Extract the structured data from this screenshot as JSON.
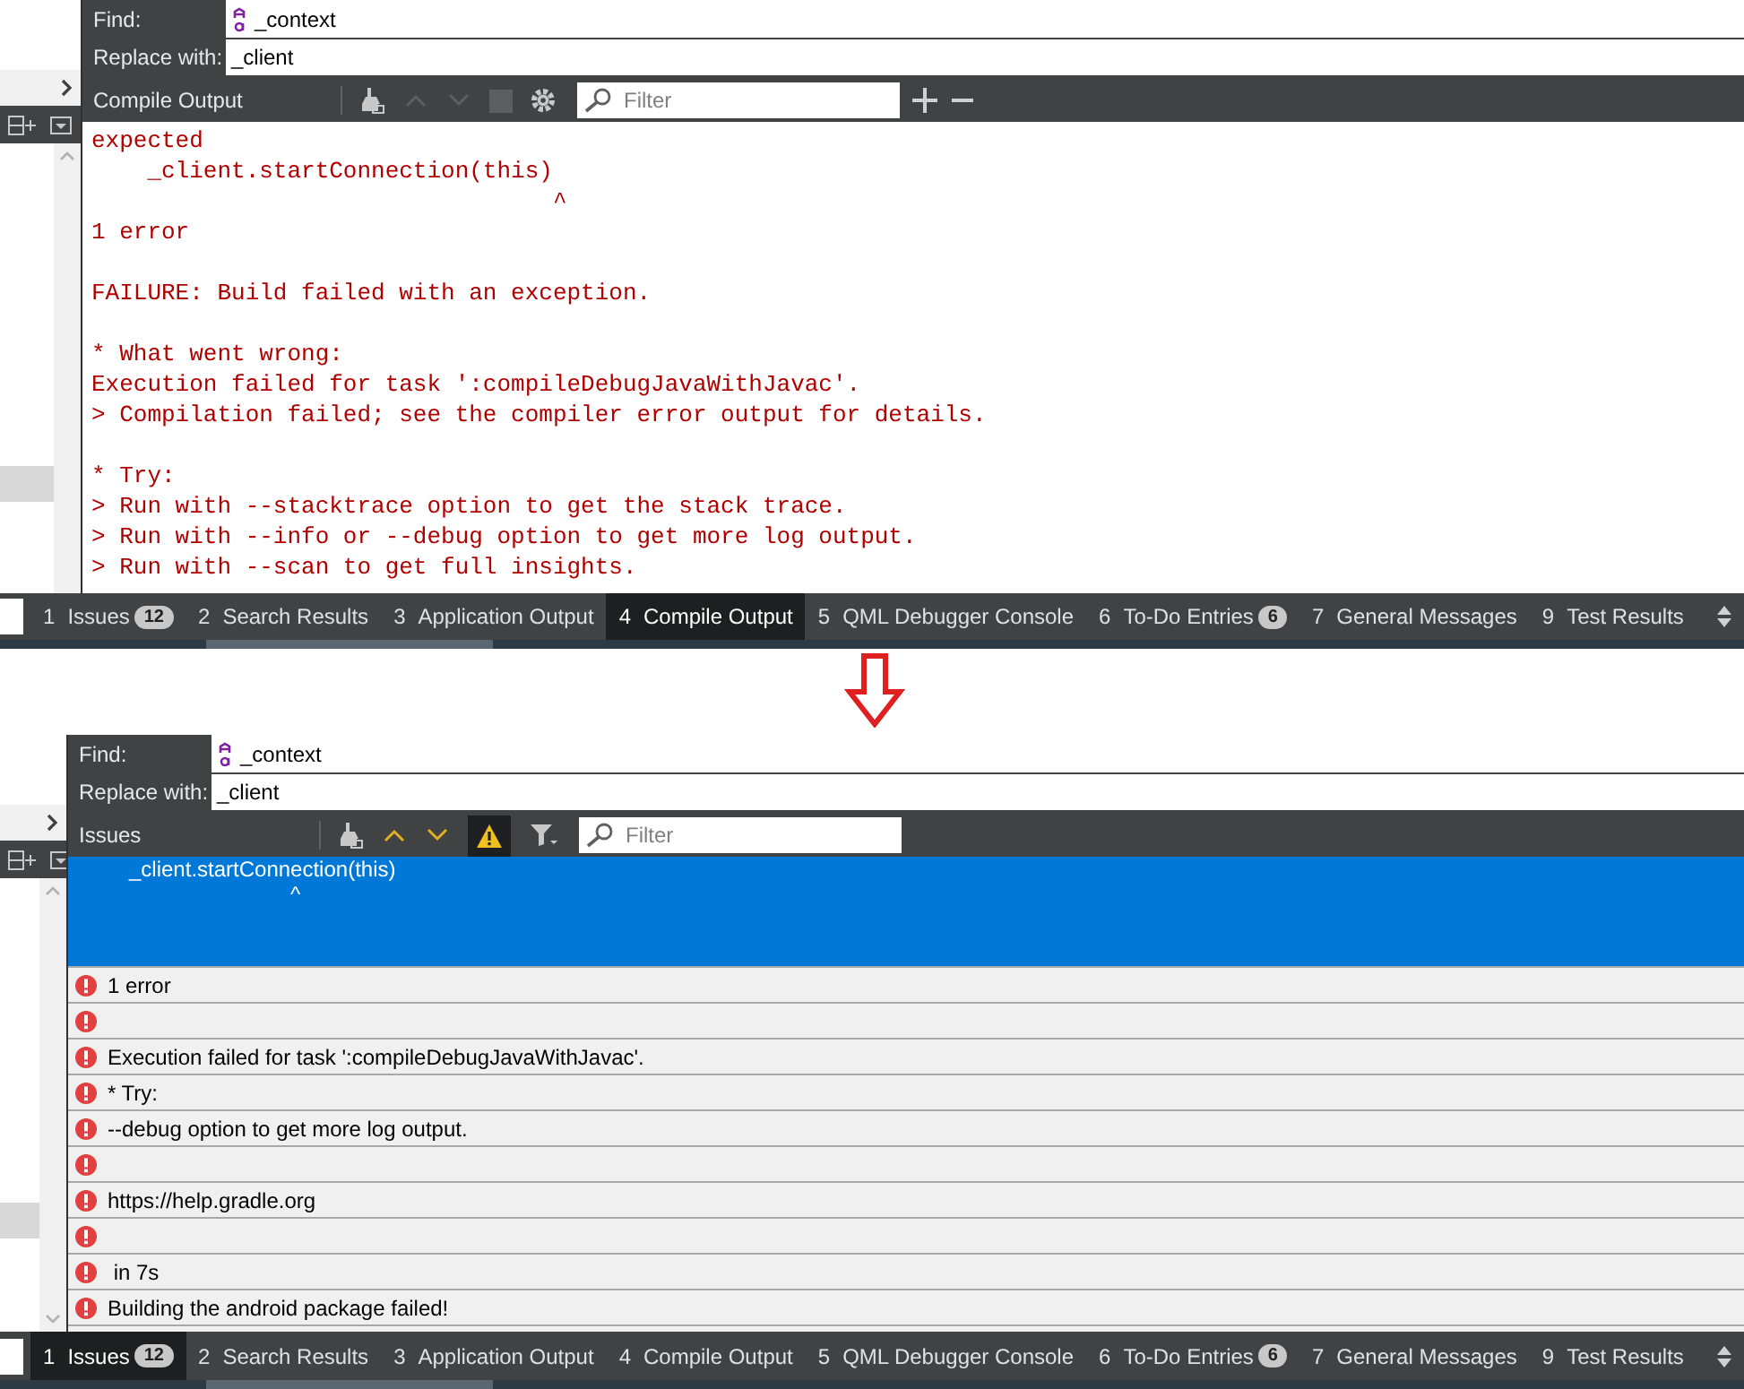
{
  "panels": [
    {
      "kind": "compile_output",
      "find": {
        "label": "Find:",
        "value": "_context"
      },
      "replace": {
        "label": "Replace with:",
        "value": "_client"
      },
      "pane_title": "Compile Output",
      "toolbar": [
        {
          "kind": "clean",
          "disabled": false
        },
        {
          "kind": "prev",
          "disabled": true
        },
        {
          "kind": "next",
          "disabled": true
        },
        {
          "kind": "stop",
          "disabled": true
        },
        {
          "kind": "settings",
          "disabled": false
        }
      ],
      "filter": {
        "placeholder": "Filter"
      },
      "zoom_buttons": true,
      "output_blocks": [
        [
          "expected",
          "    _client.startConnection(this)",
          "                                 ^",
          "1 error"
        ],
        [
          "FAILURE: Build failed with an exception."
        ],
        [
          "* What went wrong:",
          "Execution failed for task ':compileDebugJavaWithJavac'.",
          "> Compilation failed; see the compiler error output for details."
        ],
        [
          "* Try:",
          "> Run with --stacktrace option to get the stack trace.",
          "> Run with --info or --debug option to get more log output.",
          "> Run with --scan to get full insights."
        ]
      ],
      "tabs": [
        {
          "number": "1",
          "label": "Issues",
          "badge": "12",
          "selected": false
        },
        {
          "number": "2",
          "label": "Search Results",
          "selected": false
        },
        {
          "number": "3",
          "label": "Application Output",
          "selected": false
        },
        {
          "number": "4",
          "label": "Compile Output",
          "selected": true
        },
        {
          "number": "5",
          "label": "QML Debugger Console",
          "selected": false
        },
        {
          "number": "6",
          "label": "To-Do Entries",
          "badge": "6",
          "selected": false
        },
        {
          "number": "7",
          "label": "General Messages",
          "selected": false
        },
        {
          "number": "9",
          "label": "Test Results",
          "selected": false
        }
      ]
    },
    {
      "kind": "issues",
      "find": {
        "label": "Find:",
        "value": "_context"
      },
      "replace": {
        "label": "Replace with:",
        "value": "_client"
      },
      "pane_title": "Issues",
      "toolbar": [
        {
          "kind": "clean",
          "disabled": false
        },
        {
          "kind": "prev",
          "disabled": false
        },
        {
          "kind": "next",
          "disabled": false
        },
        {
          "kind": "warnings",
          "disabled": false,
          "on": true
        },
        {
          "kind": "funnel",
          "disabled": false
        }
      ],
      "filter": {
        "placeholder": "Filter"
      },
      "zoom_buttons": false,
      "issues": [
        {
          "lines": [
            "_client.startConnection(this)",
            "                           ^"
          ],
          "selected": true
        },
        {
          "text": "1 error",
          "selected": false
        },
        {
          "selected": false
        },
        {
          "text": "Execution failed for task ':compileDebugJavaWithJavac'.",
          "selected": false
        },
        {
          "text": "* Try:",
          "selected": false
        },
        {
          "text": "--debug option to get more log output.",
          "selected": false
        },
        {
          "selected": false
        },
        {
          "text": "https://help.gradle.org",
          "selected": false
        },
        {
          "selected": false
        },
        {
          "text": " in 7s",
          "selected": false
        },
        {
          "text": "Building the android package failed!",
          "selected": false
        }
      ],
      "tabs": [
        {
          "number": "1",
          "label": "Issues",
          "badge": "12",
          "selected": true
        },
        {
          "number": "2",
          "label": "Search Results",
          "selected": false
        },
        {
          "number": "3",
          "label": "Application Output",
          "selected": false
        },
        {
          "number": "4",
          "label": "Compile Output",
          "selected": false
        },
        {
          "number": "5",
          "label": "QML Debugger Console",
          "selected": false
        },
        {
          "number": "6",
          "label": "To-Do Entries",
          "badge": "6",
          "selected": false
        },
        {
          "number": "7",
          "label": "General Messages",
          "selected": false
        },
        {
          "number": "9",
          "label": "Test Results",
          "selected": false
        }
      ]
    }
  ]
}
